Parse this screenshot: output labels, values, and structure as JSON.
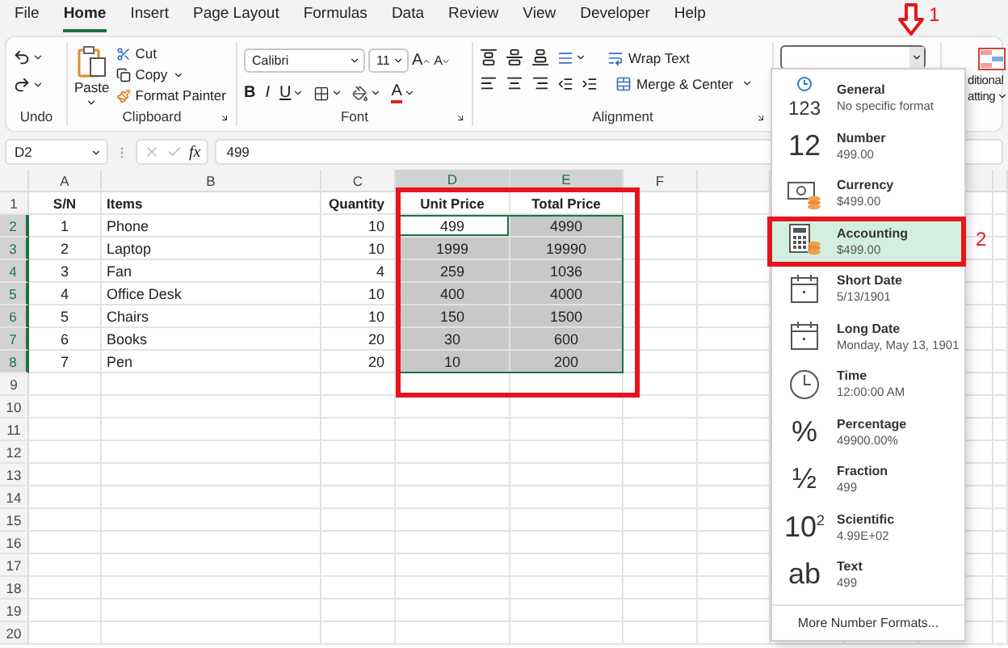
{
  "menu": [
    {
      "label": "File",
      "selected": false
    },
    {
      "label": "Home",
      "selected": true
    },
    {
      "label": "Insert",
      "selected": false
    },
    {
      "label": "Page Layout",
      "selected": false
    },
    {
      "label": "Formulas",
      "selected": false
    },
    {
      "label": "Data",
      "selected": false
    },
    {
      "label": "Review",
      "selected": false
    },
    {
      "label": "View",
      "selected": false
    },
    {
      "label": "Developer",
      "selected": false
    },
    {
      "label": "Help",
      "selected": false
    }
  ],
  "ribbon": {
    "undo": {
      "label": "Undo"
    },
    "clipboard": {
      "label": "Clipboard",
      "paste": "Paste",
      "cut": "Cut",
      "copy": "Copy",
      "format_painter": "Format Painter"
    },
    "font": {
      "label": "Font",
      "name": "Calibri",
      "size": "11",
      "grow": "A",
      "shrink": "A",
      "bold": "B",
      "italic": "I",
      "underline": "U",
      "font_color": "A"
    },
    "alignment": {
      "label": "Alignment",
      "wrap": "Wrap Text",
      "merge": "Merge & Center"
    },
    "conditional": {
      "line_1": "ditional",
      "line_2": "atting"
    }
  },
  "formula_bar": {
    "name_box": "D2",
    "fx": "fx",
    "value": "499"
  },
  "sheet": {
    "columns": [
      "A",
      "B",
      "C",
      "D",
      "E",
      "F"
    ],
    "rows": [
      {
        "kind": "header",
        "number": "1",
        "cells": [
          {
            "text": "S/N",
            "selected": false,
            "active": false
          },
          {
            "text": "Items",
            "selected": false,
            "active": false
          },
          {
            "text": "Quantity",
            "selected": false,
            "active": false
          },
          {
            "text": "Unit Price",
            "selected": false,
            "active": false
          },
          {
            "text": "Total Price",
            "selected": false,
            "active": false
          }
        ]
      },
      {
        "kind": "data",
        "number": "2",
        "cells": [
          {
            "text": "1",
            "selected": false,
            "active": false
          },
          {
            "text": "Phone",
            "selected": false,
            "active": false
          },
          {
            "text": "10",
            "selected": false,
            "active": false
          },
          {
            "text": "499",
            "selected": true,
            "active": true
          },
          {
            "text": "4990",
            "selected": true,
            "active": false
          }
        ]
      },
      {
        "kind": "data",
        "number": "3",
        "cells": [
          {
            "text": "2",
            "selected": false,
            "active": false
          },
          {
            "text": "Laptop",
            "selected": false,
            "active": false
          },
          {
            "text": "10",
            "selected": false,
            "active": false
          },
          {
            "text": "1999",
            "selected": true,
            "active": false
          },
          {
            "text": "19990",
            "selected": true,
            "active": false
          }
        ]
      },
      {
        "kind": "data",
        "number": "4",
        "cells": [
          {
            "text": "3",
            "selected": false,
            "active": false
          },
          {
            "text": "Fan",
            "selected": false,
            "active": false
          },
          {
            "text": "4",
            "selected": false,
            "active": false
          },
          {
            "text": "259",
            "selected": true,
            "active": false
          },
          {
            "text": "1036",
            "selected": true,
            "active": false
          }
        ]
      },
      {
        "kind": "data",
        "number": "5",
        "cells": [
          {
            "text": "4",
            "selected": false,
            "active": false
          },
          {
            "text": "Office Desk",
            "selected": false,
            "active": false
          },
          {
            "text": "10",
            "selected": false,
            "active": false
          },
          {
            "text": "400",
            "selected": true,
            "active": false
          },
          {
            "text": "4000",
            "selected": true,
            "active": false
          }
        ]
      },
      {
        "kind": "data",
        "number": "6",
        "cells": [
          {
            "text": "5",
            "selected": false,
            "active": false
          },
          {
            "text": "Chairs",
            "selected": false,
            "active": false
          },
          {
            "text": "10",
            "selected": false,
            "active": false
          },
          {
            "text": "150",
            "selected": true,
            "active": false
          },
          {
            "text": "1500",
            "selected": true,
            "active": false
          }
        ]
      },
      {
        "kind": "data",
        "number": "7",
        "cells": [
          {
            "text": "6",
            "selected": false,
            "active": false
          },
          {
            "text": "Books",
            "selected": false,
            "active": false
          },
          {
            "text": "20",
            "selected": false,
            "active": false
          },
          {
            "text": "30",
            "selected": true,
            "active": false
          },
          {
            "text": "600",
            "selected": true,
            "active": false
          }
        ]
      },
      {
        "kind": "data",
        "number": "8",
        "cells": [
          {
            "text": "7",
            "selected": false,
            "active": false
          },
          {
            "text": "Pen",
            "selected": false,
            "active": false
          },
          {
            "text": "20",
            "selected": false,
            "active": false
          },
          {
            "text": "10",
            "selected": true,
            "active": false
          },
          {
            "text": "200",
            "selected": true,
            "active": false
          }
        ]
      },
      {
        "number": "9"
      },
      {
        "number": "10"
      },
      {
        "number": "11"
      },
      {
        "number": "12"
      },
      {
        "number": "13"
      },
      {
        "number": "14"
      },
      {
        "number": "15"
      },
      {
        "number": "16"
      },
      {
        "number": "17"
      },
      {
        "number": "18"
      },
      {
        "number": "19"
      },
      {
        "number": "20"
      }
    ]
  },
  "number_menu": {
    "items": [
      {
        "kind": "general",
        "symbol": "123",
        "name": "General",
        "sample": "No specific format",
        "selected": false
      },
      {
        "kind": "number",
        "symbol": "12",
        "name": "Number",
        "sample": "499.00",
        "selected": false
      },
      {
        "kind": "currency",
        "name": "Currency",
        "sample": "$499.00",
        "selected": false
      },
      {
        "kind": "accounting",
        "name": "Accounting",
        "sample": "$499.00",
        "selected": true
      },
      {
        "kind": "short_date",
        "name": "Short Date",
        "sample": "5/13/1901",
        "selected": false
      },
      {
        "kind": "long_date",
        "name": "Long Date",
        "sample": "Monday, May 13, 1901",
        "selected": false
      },
      {
        "kind": "time",
        "name": "Time",
        "sample": "12:00:00 AM",
        "selected": false
      },
      {
        "kind": "percentage",
        "symbol": "%",
        "name": "Percentage",
        "sample": "49900.00%",
        "selected": false
      },
      {
        "kind": "fraction",
        "symbol": "½",
        "name": "Fraction",
        "sample": "499",
        "selected": false
      },
      {
        "kind": "scientific",
        "symbol": "10$^{2}$",
        "name": "Scientific",
        "sample": "4.99E+02",
        "selected": false
      },
      {
        "kind": "text",
        "symbol": "ab",
        "name": "Text",
        "sample": "499",
        "selected": false
      }
    ],
    "footer": "More Number Formats..."
  },
  "annotations": [
    {
      "kind": "arrow",
      "label": "1"
    },
    {
      "kind": "item_box",
      "label": "2"
    },
    {
      "kind": "range_box"
    }
  ]
}
